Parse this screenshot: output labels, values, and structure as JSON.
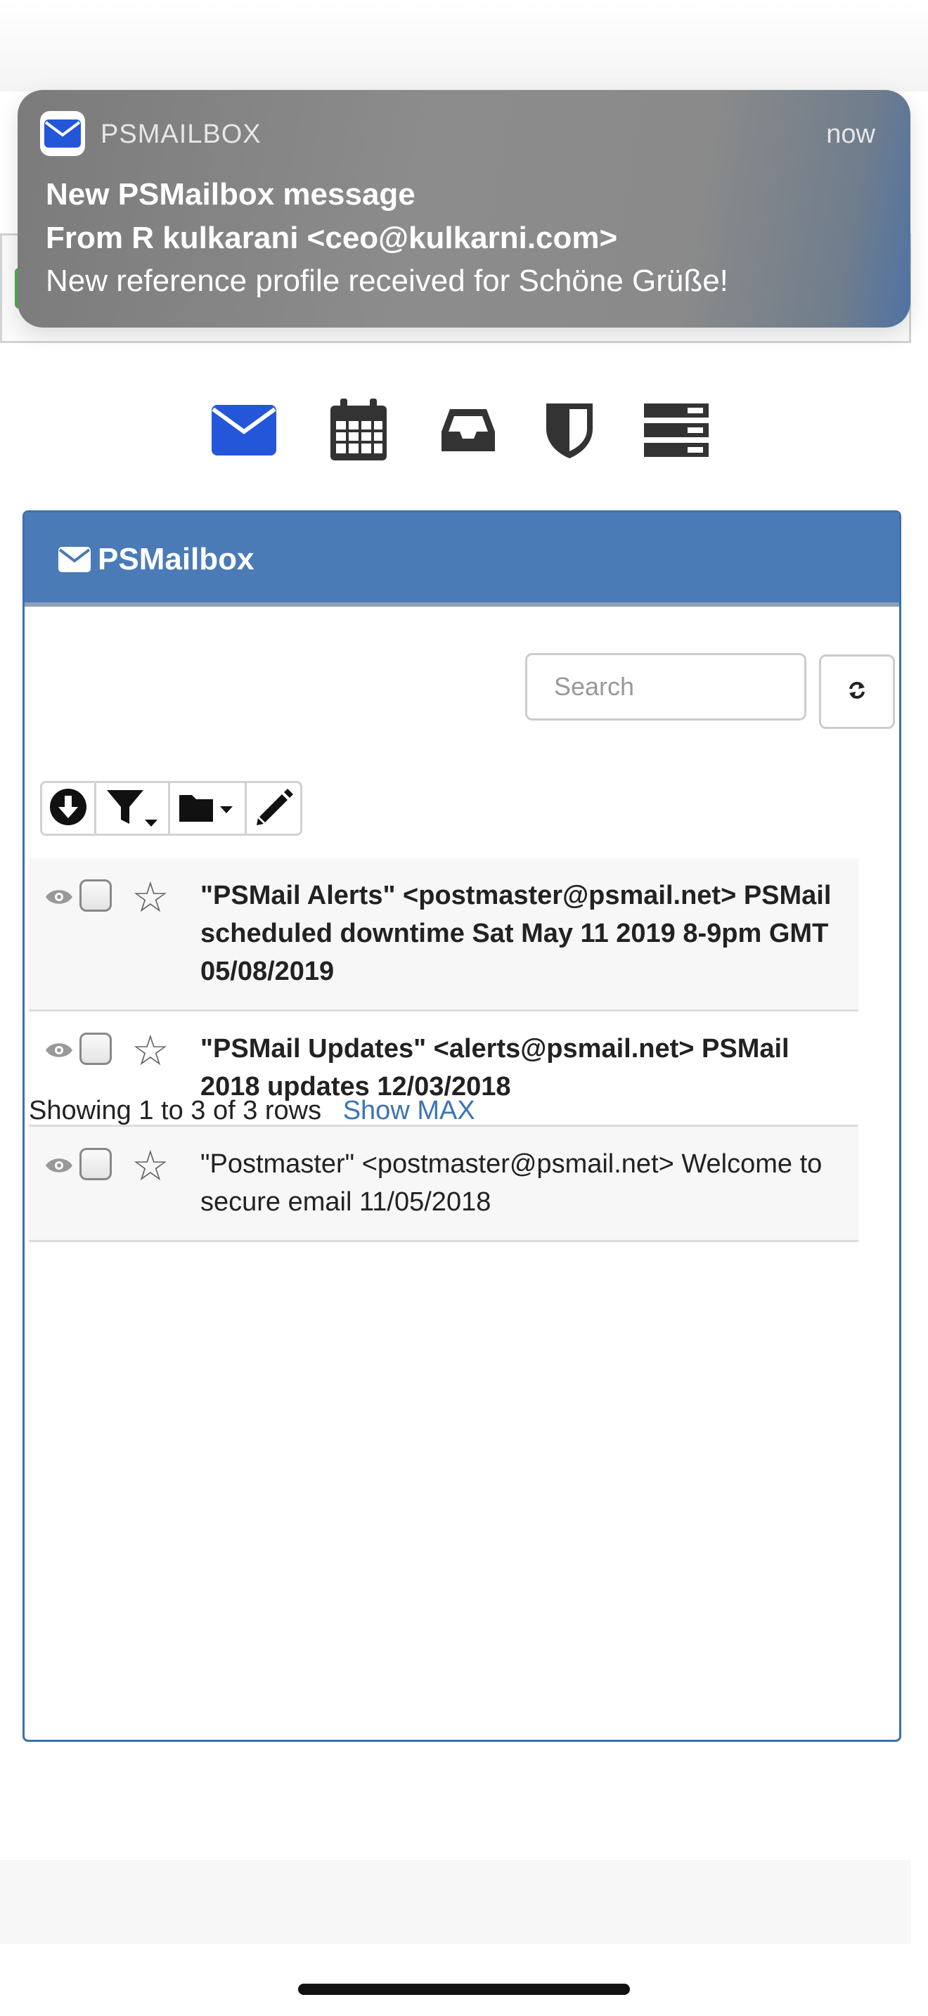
{
  "notification": {
    "app_name": "PSMAILBOX",
    "time": "now",
    "title": "New PSMailbox message",
    "from": "From R kulkarani <ceo@kulkarni.com>",
    "body": "New reference profile received for  Schöne Grüße!",
    "app_icon": "envelope-icon",
    "accent": "#2456d9"
  },
  "nav_icons": [
    "envelope-icon",
    "calendar-icon",
    "inbox-tray-icon",
    "shield-icon",
    "server-list-icon"
  ],
  "panel": {
    "title": "PSMailbox",
    "title_icon": "envelope-icon",
    "header_color": "#4a7bb7"
  },
  "search": {
    "placeholder": "Search",
    "value": ""
  },
  "toolbar": {
    "buttons": [
      "download-icon",
      "filter-dropdown-icon",
      "folder-dropdown-icon",
      "pencil-icon"
    ]
  },
  "messages": [
    {
      "text": "\"PSMail Alerts\" <postmaster@psmail.net> PSMail scheduled downtime Sat May 11 2019 8-9pm GMT 05/08/2019",
      "unread": true
    },
    {
      "text": "\"PSMail Updates\" <alerts@psmail.net> PSMail 2018 updates 12/03/2018",
      "unread": true
    },
    {
      "text": "\"Postmaster\" <postmaster@psmail.net> Welcome to secure email 11/05/2018",
      "unread": false
    }
  ],
  "pagination": {
    "summary": "Showing 1 to 3 of 3 rows",
    "show_max": "Show MAX"
  }
}
